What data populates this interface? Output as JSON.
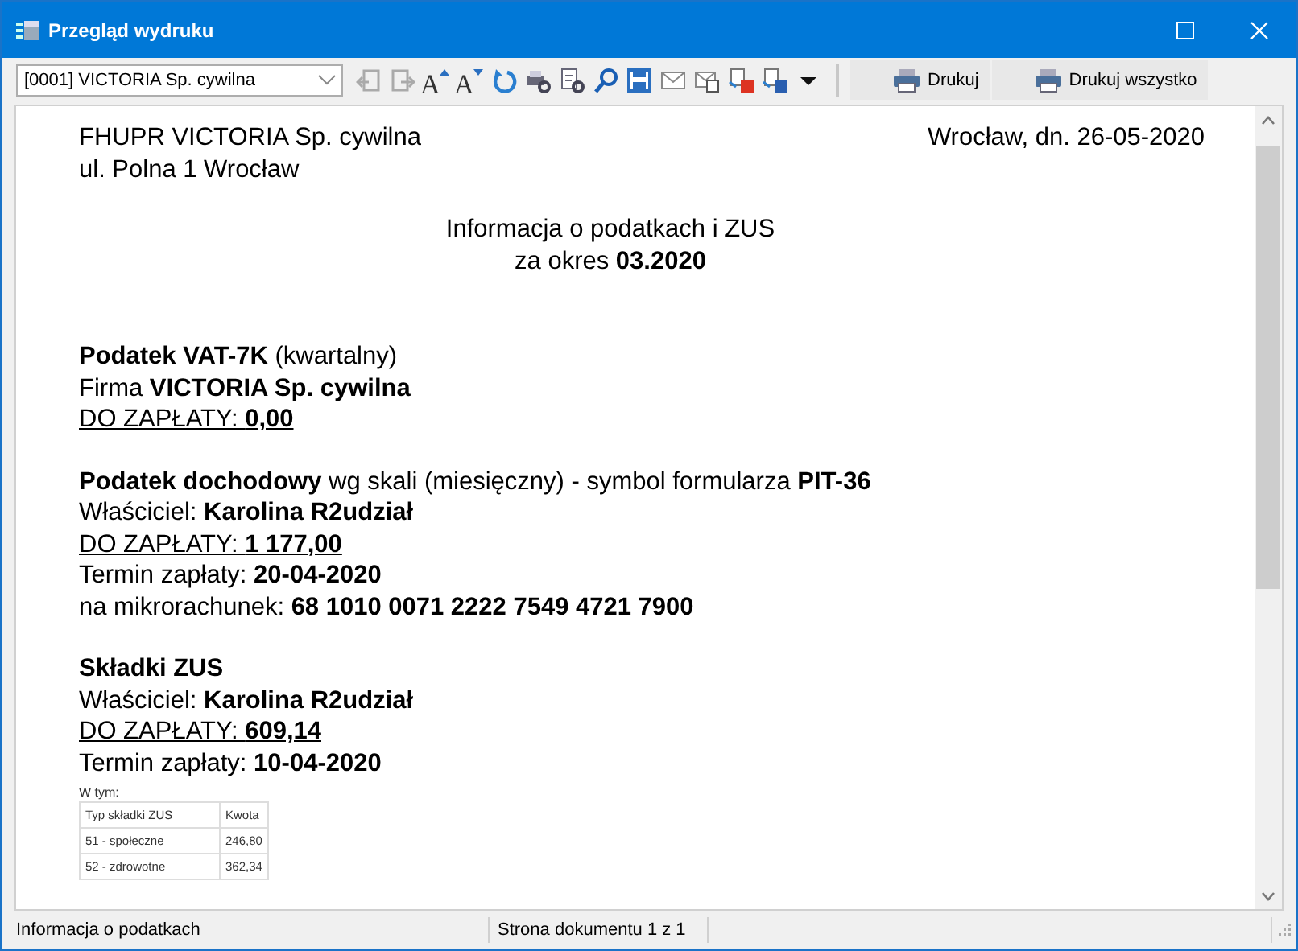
{
  "window": {
    "title": "Przegląd wydruku"
  },
  "toolbar": {
    "company_select": {
      "value": "[0001] VICTORIA Sp. cywilna"
    },
    "font_buttons": [
      {
        "kind": "increase",
        "label": "A"
      },
      {
        "kind": "decrease",
        "label": "A"
      }
    ],
    "buttons": [
      "Drukuj",
      "Drukuj wszystko"
    ]
  },
  "document": {
    "header_left": [
      "FHUPR VICTORIA Sp. cywilna",
      "ul. Polna 1 Wrocław"
    ],
    "header_right": "Wrocław, dn. 26-05-2020",
    "title": [
      "Informacja o podatkach i ZUS",
      "za okres **03.2020**"
    ],
    "sections": [
      {
        "lines": [
          {
            "kind": "plain",
            "text": "**Podatek VAT-7K** (kwartalny)"
          },
          {
            "kind": "plain",
            "text": "Firma **VICTORIA Sp. cywilna**"
          },
          {
            "kind": "due",
            "text": "DO ZAPŁATY: **0,00**"
          }
        ]
      },
      {
        "lines": [
          {
            "kind": "plain",
            "text": "**Podatek dochodowy** wg skali (miesięczny) - symbol formularza **PIT-36**"
          },
          {
            "kind": "plain",
            "text": "Właściciel: **Karolina R2udział**"
          },
          {
            "kind": "due",
            "text": "DO ZAPŁATY: **1 177,00**"
          },
          {
            "kind": "plain",
            "text": "Termin zapłaty: **20-04-2020**"
          },
          {
            "kind": "plain",
            "text": "na mikrorachunek: **68 1010 0071 2222 7549 4721 7900**"
          }
        ]
      },
      {
        "lines": [
          {
            "kind": "plain",
            "text": "**Składki ZUS**"
          },
          {
            "kind": "plain",
            "text": "Właściciel: **Karolina R2udział**"
          },
          {
            "kind": "due",
            "text": "DO ZAPŁATY: **609,14**"
          },
          {
            "kind": "plain",
            "text": "Termin zapłaty: **10-04-2020**"
          }
        ]
      }
    ],
    "zus_table": {
      "caption": "W tym:",
      "columns": [
        "Typ składki ZUS",
        "Kwota"
      ],
      "rows": [
        [
          "51 - społeczne",
          "246,80"
        ],
        [
          "52 - zdrowotne",
          "362,34"
        ]
      ]
    }
  },
  "status_bar": [
    "Informacja o podatkach",
    "Strona dokumentu 1 z 1"
  ]
}
